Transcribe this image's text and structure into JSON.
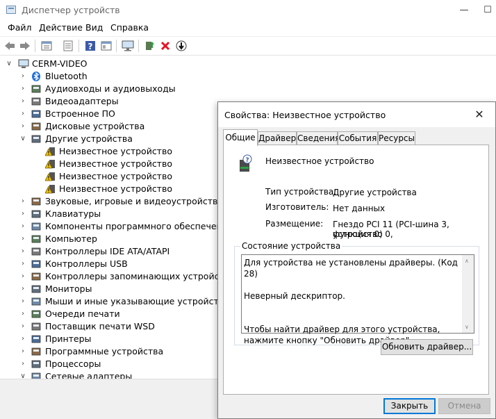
{
  "window": {
    "title": "Диспетчер устройств",
    "minimize": "—",
    "maximize": "☐"
  },
  "menu": [
    "Файл",
    "Действие",
    "Вид",
    "Справка"
  ],
  "toolbar": {
    "buttons": [
      "back-arrow-icon",
      "forward-arrow-icon",
      "properties-sheet-icon",
      "device-list-icon",
      "help-icon",
      "view-icon",
      "monitor-icon",
      "update-driver-icon",
      "uninstall-icon",
      "disable-device-icon"
    ]
  },
  "tree": {
    "root": "CERM-VIDEO",
    "items": [
      {
        "label": "Bluetooth",
        "icon": "bluetooth-icon",
        "expanded": false
      },
      {
        "label": "Аудиовходы и аудиовыходы",
        "icon": "speaker-icon",
        "expanded": false
      },
      {
        "label": "Видеоадаптеры",
        "icon": "display-adapter-icon",
        "expanded": false
      },
      {
        "label": "Встроенное ПО",
        "icon": "firmware-icon",
        "expanded": false
      },
      {
        "label": "Дисковые устройства",
        "icon": "disk-drive-icon",
        "expanded": false
      },
      {
        "label": "Другие устройства",
        "icon": "other-devices-icon",
        "expanded": true
      },
      {
        "label": "Неизвестное устройство",
        "icon": "warning-device-icon",
        "child": true
      },
      {
        "label": "Неизвестное устройство",
        "icon": "warning-device-icon",
        "child": true
      },
      {
        "label": "Неизвестное устройство",
        "icon": "warning-device-icon",
        "child": true
      },
      {
        "label": "Неизвестное устройство",
        "icon": "warning-device-icon",
        "child": true
      },
      {
        "label": "Звуковые, игровые и видеоустройства",
        "icon": "sound-icon",
        "expanded": false
      },
      {
        "label": "Клавиатуры",
        "icon": "keyboard-icon",
        "expanded": false
      },
      {
        "label": "Компоненты программного обеспечения",
        "icon": "software-component-icon",
        "expanded": false
      },
      {
        "label": "Компьютер",
        "icon": "computer-icon",
        "expanded": false
      },
      {
        "label": "Контроллеры IDE ATA/ATAPI",
        "icon": "ide-controller-icon",
        "expanded": false
      },
      {
        "label": "Контроллеры USB",
        "icon": "usb-icon",
        "expanded": false
      },
      {
        "label": "Контроллеры запоминающих устройств",
        "icon": "storage-controller-icon",
        "expanded": false
      },
      {
        "label": "Мониторы",
        "icon": "monitor-icon",
        "expanded": false
      },
      {
        "label": "Мыши и иные указывающие устройства",
        "icon": "mouse-icon",
        "expanded": false
      },
      {
        "label": "Очереди печати",
        "icon": "print-queue-icon",
        "expanded": false
      },
      {
        "label": "Поставщик печати WSD",
        "icon": "wsd-printer-icon",
        "expanded": false
      },
      {
        "label": "Принтеры",
        "icon": "printer-icon",
        "expanded": false
      },
      {
        "label": "Программные устройства",
        "icon": "software-device-icon",
        "expanded": false
      },
      {
        "label": "Процессоры",
        "icon": "processor-icon",
        "expanded": false
      },
      {
        "label": "Сетевые адаптеры",
        "icon": "network-adapter-icon",
        "expanded": true
      }
    ]
  },
  "dialog": {
    "title": "Свойства: Неизвестное устройство",
    "tabs": [
      "Общие",
      "Драйвер",
      "Сведения",
      "События",
      "Ресурсы"
    ],
    "device_name": "Неизвестное устройство",
    "type_label": "Тип устройства:",
    "type_value": "Другие устройства",
    "manufacturer_label": "Изготовитель:",
    "manufacturer_value": "Нет данных",
    "location_label": "Размещение:",
    "location_value_1": "Гнездо PCI 11 (PCI-шина 3, устройство 0,",
    "location_value_2": "функция 0)",
    "status_legend": "Состояние устройства",
    "status_text": "Для устройства не установлены драйверы. (Код 28)\n\nНеверный дескриптор.\n\n\nЧтобы найти драйвер для этого устройства, нажмите кнопку \"Обновить драйвер\".",
    "update_button": "Обновить драйвер...",
    "close_button": "Закрыть",
    "cancel_button": "Отмена"
  },
  "colors": {
    "accent": "#0078d7",
    "warning": "#f2c200",
    "error": "#e81123"
  }
}
